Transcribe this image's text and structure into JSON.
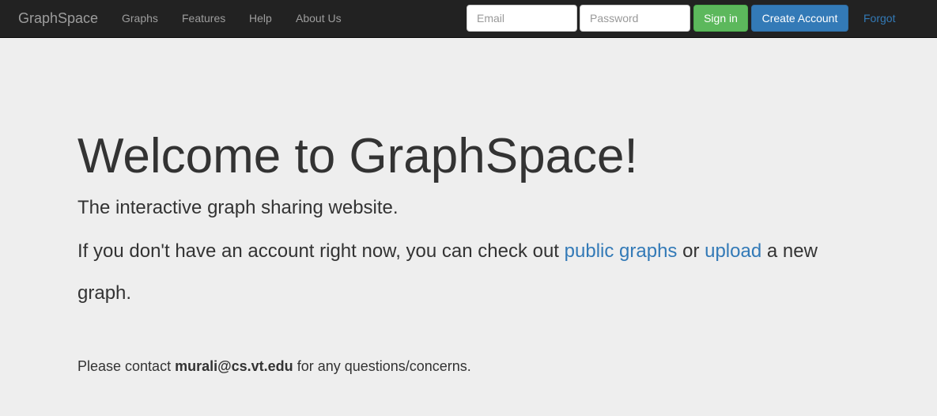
{
  "navbar": {
    "brand": "GraphSpace",
    "links": [
      "Graphs",
      "Features",
      "Help",
      "About Us"
    ],
    "email_placeholder": "Email",
    "password_placeholder": "Password",
    "sign_in_label": "Sign in",
    "create_account_label": "Create Account",
    "forgot_label": "Forgot"
  },
  "hero": {
    "title": "Welcome to GraphSpace!",
    "subtitle": "The interactive graph sharing website.",
    "line_prefix": "If you don't have an account right now, you can check out ",
    "public_graphs_link": "public graphs",
    "line_middle": " or ",
    "upload_link": "upload",
    "line_suffix": " a new graph.",
    "contact_prefix": "Please contact ",
    "contact_email": "murali@cs.vt.edu",
    "contact_suffix": " for any questions/concerns."
  },
  "colors": {
    "navbar_bg": "#222222",
    "page_bg": "#eeeeee",
    "link": "#337ab7",
    "success": "#5cb85c",
    "primary": "#337ab7"
  }
}
